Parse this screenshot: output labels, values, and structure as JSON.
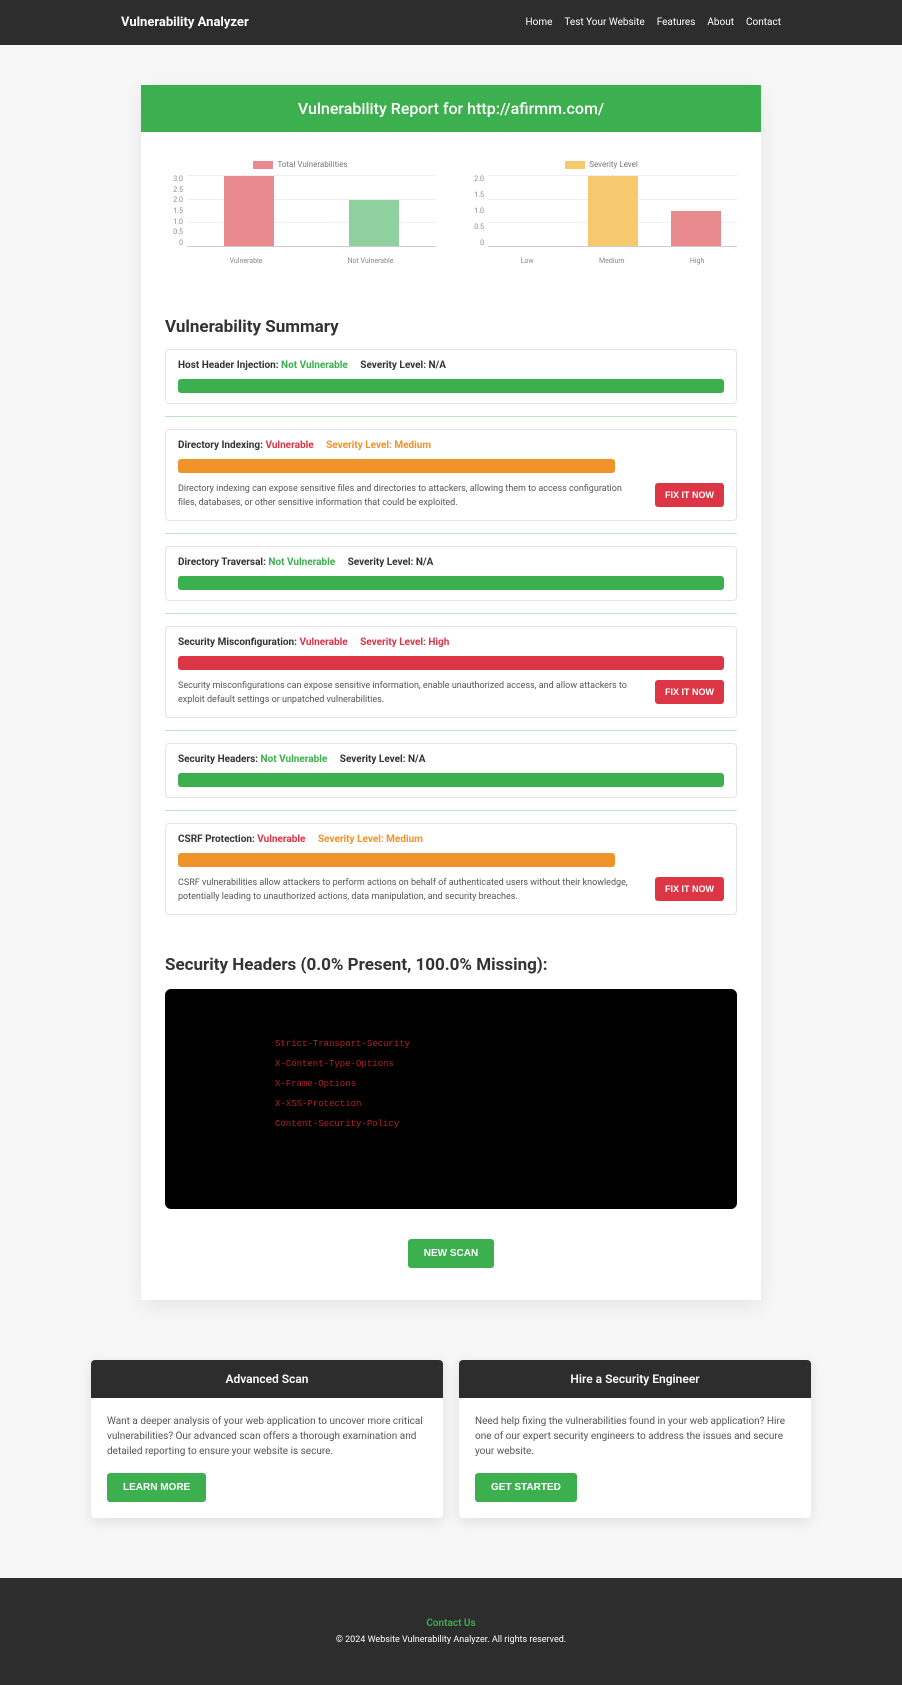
{
  "nav": {
    "brand": "Vulnerability Analyzer",
    "links": [
      "Home",
      "Test Your Website",
      "Features",
      "About",
      "Contact"
    ]
  },
  "report_title": "Vulnerability Report for http://afirmm.com/",
  "chart_data": [
    {
      "type": "bar",
      "legend": "Total Vulnerabilities",
      "categories": [
        "Vulnerable",
        "Not Vulnerable"
      ],
      "values": [
        3,
        2
      ],
      "ylim": [
        0,
        3
      ],
      "yticks": [
        "3.0",
        "2.5",
        "2.0",
        "1.5",
        "1.0",
        "0.5",
        "0"
      ],
      "colors": [
        "#e98b8e",
        "#8fd19e"
      ]
    },
    {
      "type": "bar",
      "legend": "Severity Level",
      "categories": [
        "Low",
        "Medium",
        "High"
      ],
      "values": [
        0,
        2,
        1
      ],
      "ylim": [
        0,
        2
      ],
      "yticks": [
        "2.0",
        "1.5",
        "1.0",
        "0.5",
        "0"
      ],
      "colors": [
        "#8fd19e",
        "#f6c96f",
        "#e98b8e"
      ]
    }
  ],
  "summary_title": "Vulnerability Summary",
  "fix_label": "FIX IT NOW",
  "vulns": [
    {
      "name": "Host Header Injection:",
      "status": "Not Vulnerable",
      "ok": true,
      "sev_label": "Severity Level: N/A",
      "sev": "na",
      "desc": ""
    },
    {
      "name": "Directory Indexing:",
      "status": "Vulnerable",
      "ok": false,
      "sev_label": "Severity Level: Medium",
      "sev": "med",
      "desc": "Directory indexing can expose sensitive files and directories to attackers, allowing them to access configuration files, databases, or other sensitive information that could be exploited."
    },
    {
      "name": "Directory Traversal:",
      "status": "Not Vulnerable",
      "ok": true,
      "sev_label": "Severity Level: N/A",
      "sev": "na",
      "desc": ""
    },
    {
      "name": "Security Misconfiguration:",
      "status": "Vulnerable",
      "ok": false,
      "sev_label": "Severity Level: High",
      "sev": "high",
      "desc": "Security misconfigurations can expose sensitive information, enable unauthorized access, and allow attackers to exploit default settings or unpatched vulnerabilities."
    },
    {
      "name": "Security Headers:",
      "status": "Not Vulnerable",
      "ok": true,
      "sev_label": "Severity Level: N/A",
      "sev": "na",
      "desc": ""
    },
    {
      "name": "CSRF Protection:",
      "status": "Vulnerable",
      "ok": false,
      "sev_label": "Severity Level: Medium",
      "sev": "med",
      "desc": "CSRF vulnerabilities allow attackers to perform actions on behalf of authenticated users without their knowledge, potentially leading to unauthorized actions, data manipulation, and security breaches."
    }
  ],
  "headers_title": "Security Headers (0.0% Present, 100.0% Missing):",
  "headers": [
    {
      "name": "Strict-Transport-Security",
      "present": false
    },
    {
      "name": "X-Content-Type-Options",
      "present": false
    },
    {
      "name": "X-Frame-Options",
      "present": false
    },
    {
      "name": "X-XSS-Protection",
      "present": false
    },
    {
      "name": "Content-Security-Policy",
      "present": false
    }
  ],
  "new_scan": "NEW SCAN",
  "cards": [
    {
      "title": "Advanced Scan",
      "text": "Want a deeper analysis of your web application to uncover more critical vulnerabilities? Our advanced scan offers a thorough examination and detailed reporting to ensure your website is secure.",
      "cta": "LEARN MORE"
    },
    {
      "title": "Hire a Security Engineer",
      "text": "Need help fixing the vulnerabilities found in your web application? Hire one of our expert security engineers to address the issues and secure your website.",
      "cta": "GET STARTED"
    }
  ],
  "footer": {
    "contact": "Contact Us",
    "copy": "© 2024 Website Vulnerability Analyzer. All rights reserved."
  }
}
